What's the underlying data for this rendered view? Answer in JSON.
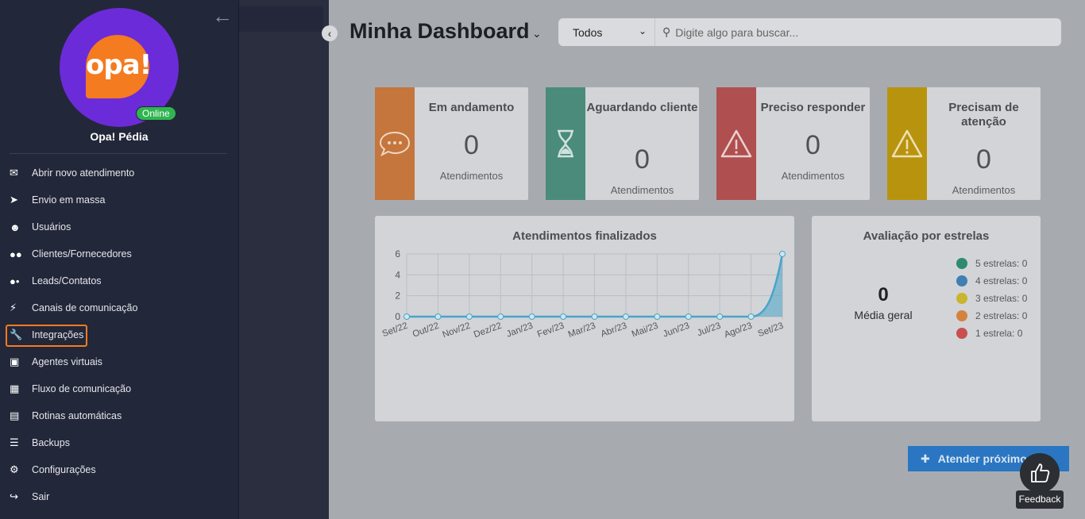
{
  "sidebar": {
    "org_name": "Opa! Pédia",
    "logo_text": "opa!",
    "status": "Online",
    "items": [
      {
        "label": "Abrir novo atendimento",
        "icon": "envelope-icon"
      },
      {
        "label": "Envio em massa",
        "icon": "paper-plane-icon"
      },
      {
        "label": "Usuários",
        "icon": "user-headset-icon"
      },
      {
        "label": "Clientes/Fornecedores",
        "icon": "users-icon"
      },
      {
        "label": "Leads/Contatos",
        "icon": "user-group-icon"
      },
      {
        "label": "Canais de comunicação",
        "icon": "plug-icon"
      },
      {
        "label": "Integrações",
        "icon": "wrench-icon"
      },
      {
        "label": "Agentes virtuais",
        "icon": "robot-icon"
      },
      {
        "label": "Fluxo de comunicação",
        "icon": "flow-icon"
      },
      {
        "label": "Rotinas automáticas",
        "icon": "calendar-icon"
      },
      {
        "label": "Backups",
        "icon": "database-icon"
      },
      {
        "label": "Configurações",
        "icon": "gears-icon"
      },
      {
        "label": "Sair",
        "icon": "sign-out-icon"
      }
    ],
    "active_item": "Integrações"
  },
  "header": {
    "title": "Minha Dashboard",
    "filter_selected": "Todos",
    "search_placeholder": "Digite algo para buscar..."
  },
  "cards": [
    {
      "title": "Em andamento",
      "value": "0",
      "unit": "Atendimentos",
      "color": "#c4763d",
      "icon": "chat-dots-icon"
    },
    {
      "title": "Aguardando cliente",
      "value": "0",
      "unit": "Atendimentos",
      "color": "#4b8b7c",
      "icon": "hourglass-icon"
    },
    {
      "title": "Preciso responder",
      "value": "0",
      "unit": "Atendimentos",
      "color": "#b04f4f",
      "icon": "warning-icon"
    },
    {
      "title": "Precisam de atenção",
      "value": "0",
      "unit": "Atendimentos",
      "color": "#b8940e",
      "icon": "warning-icon"
    }
  ],
  "chart_finalized": {
    "title": "Atendimentos finalizados"
  },
  "chart_data": {
    "type": "area",
    "title": "Atendimentos finalizados",
    "categories": [
      "Set/22",
      "Out/22",
      "Nov/22",
      "Dez/22",
      "Jan/23",
      "Fev/23",
      "Mar/23",
      "Abr/23",
      "Mai/23",
      "Jun/23",
      "Jul/23",
      "Ago/23",
      "Set/23"
    ],
    "values": [
      0,
      0,
      0,
      0,
      0,
      0,
      0,
      0,
      0,
      0,
      0,
      0,
      6
    ],
    "yticks": [
      "0",
      "2",
      "4",
      "6"
    ],
    "ylim": [
      0,
      6
    ],
    "grid": true,
    "color": "#4aa4c9"
  },
  "ratings": {
    "title": "Avaliação por estrelas",
    "average_value": "0",
    "average_label": "Média geral",
    "legend": [
      {
        "label": "5 estrelas: 0",
        "color": "#2e8b6e"
      },
      {
        "label": "4 estrelas: 0",
        "color": "#3f7fb3"
      },
      {
        "label": "3 estrelas: 0",
        "color": "#c9b52e"
      },
      {
        "label": "2 estrelas: 0",
        "color": "#d4823e"
      },
      {
        "label": "1 estrela: 0",
        "color": "#c94f4f"
      }
    ]
  },
  "actions": {
    "next_button": "Atender próximo",
    "feedback": "Feedback"
  }
}
